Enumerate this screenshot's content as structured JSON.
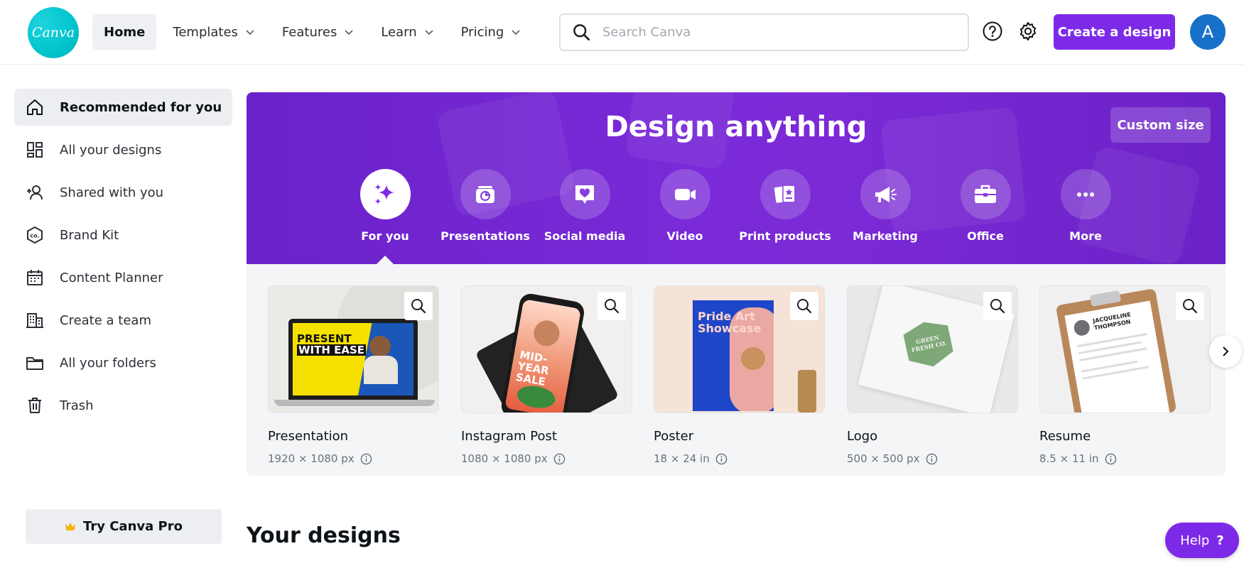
{
  "brand": {
    "logo_text": "Canva",
    "accent_color": "#7d2ae8",
    "logo_color": "#00c4cc"
  },
  "nav": {
    "items": [
      {
        "label": "Home",
        "active": true,
        "has_dropdown": false
      },
      {
        "label": "Templates",
        "has_dropdown": true
      },
      {
        "label": "Features",
        "has_dropdown": true
      },
      {
        "label": "Learn",
        "has_dropdown": true
      },
      {
        "label": "Pricing",
        "has_dropdown": true
      }
    ]
  },
  "search": {
    "placeholder": "Search Canva"
  },
  "header_actions": {
    "help_icon": "question-circle-icon",
    "settings_icon": "gear-icon",
    "create_label": "Create a design",
    "avatar_initial": "A"
  },
  "sidebar": {
    "items": [
      {
        "label": "Recommended for you",
        "icon": "home-icon",
        "active": true
      },
      {
        "label": "All your designs",
        "icon": "grid-icon"
      },
      {
        "label": "Shared with you",
        "icon": "shared-users-icon"
      },
      {
        "label": "Brand Kit",
        "icon": "brand-kit-icon"
      },
      {
        "label": "Content Planner",
        "icon": "calendar-icon"
      },
      {
        "label": "Create a team",
        "icon": "building-icon"
      },
      {
        "label": "All your folders",
        "icon": "folder-icon"
      },
      {
        "label": "Trash",
        "icon": "trash-icon"
      }
    ],
    "try_pro_label": "Try Canva Pro"
  },
  "hero": {
    "title": "Design anything",
    "custom_size_label": "Custom size",
    "categories": [
      {
        "label": "For you",
        "icon": "sparkle-icon",
        "active": true
      },
      {
        "label": "Presentations",
        "icon": "presentation-icon"
      },
      {
        "label": "Social media",
        "icon": "heart-chat-icon"
      },
      {
        "label": "Video",
        "icon": "video-camera-icon"
      },
      {
        "label": "Print products",
        "icon": "print-products-icon"
      },
      {
        "label": "Marketing",
        "icon": "megaphone-icon"
      },
      {
        "label": "Office",
        "icon": "briefcase-icon"
      },
      {
        "label": "More",
        "icon": "more-dots-icon"
      }
    ]
  },
  "templates": [
    {
      "title": "Presentation",
      "size": "1920 × 1080 px",
      "thumb_text": [
        "PRESENT",
        "WITH EASE"
      ]
    },
    {
      "title": "Instagram Post",
      "size": "1080 × 1080 px",
      "thumb_text": [
        "MID-YEAR",
        "SALE"
      ]
    },
    {
      "title": "Poster",
      "size": "18 × 24 in",
      "thumb_text": [
        "Pride Art",
        "Showcase"
      ]
    },
    {
      "title": "Logo",
      "size": "500 × 500 px",
      "thumb_text": [
        "GREEN",
        "FRESH CO."
      ]
    },
    {
      "title": "Resume",
      "size": "8.5 × 11 in",
      "thumb_text": [
        "JACQUELINE",
        "THOMPSON"
      ]
    }
  ],
  "sections": {
    "your_designs_title": "Your designs"
  },
  "help": {
    "label": "Help",
    "icon": "?"
  }
}
